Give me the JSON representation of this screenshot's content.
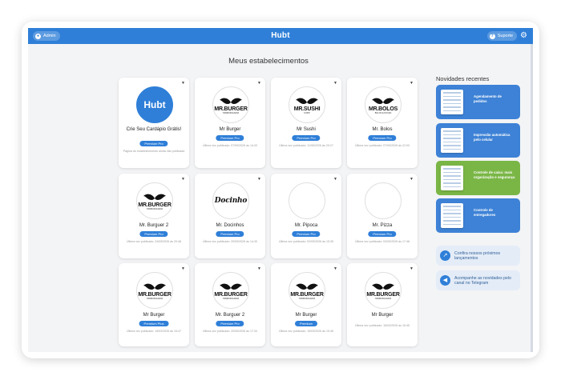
{
  "header": {
    "brand": "Hubt",
    "admin_label": "Admin",
    "support_label": "Suporte",
    "brand_color": "#2f7fd8"
  },
  "main": {
    "title": "Meus estabelecimentos",
    "cards": [
      {
        "logo_text": "Hubt",
        "logo_sub": "",
        "name": "Crie Seu Cardápio Grátis!",
        "plan": "Premium Pro",
        "meta": "Página do estabelecimento ainda não publicada"
      },
      {
        "logo_text": "MR.BURGER",
        "logo_sub": "HAMBURGUERIA",
        "name": "Mr Burger",
        "plan": "Premium Pro",
        "meta": "Última vez publicado: 07/09/2026 às 14:43"
      },
      {
        "logo_text": "MR.SUSHI",
        "logo_sub": "SUSHI",
        "name": "Mr Sushi",
        "plan": "Premium Pro",
        "meta": "Última vez publicado: 11/06/2026 às 20:27"
      },
      {
        "logo_text": "MR.BOLOS",
        "logo_sub": "BOLOS E DOCES",
        "name": "Mr. Bolos",
        "plan": "Premium Pro",
        "meta": "Última vez publicado: 07/09/2026 às 22:00"
      },
      {
        "logo_text": "MR.BURGER",
        "logo_sub": "HAMBURGUERIA",
        "name": "Mr. Burguer 2",
        "plan": "Premium Pro",
        "meta": "Última vez publicado: 24/09/2026 às 20:48"
      },
      {
        "logo_text": "Docinho",
        "logo_sub": "",
        "name": "Mr. Docinhos",
        "plan": "Premium Pro",
        "meta": "Última vez publicado: 20/09/2026 às 14:40"
      },
      {
        "logo_text": "",
        "logo_sub": "",
        "name": "Mr. Pipoca",
        "plan": "Premium Pro",
        "meta": "Última vez publicado: 02/09/2026 às 15:35"
      },
      {
        "logo_text": "",
        "logo_sub": "",
        "name": "Mr. Pizza",
        "plan": "Premium Pro",
        "meta": "Última vez publicado: 03/09/2026 às 17:48"
      },
      {
        "logo_text": "MR.BURGER",
        "logo_sub": "HAMBURGUERIA",
        "name": "Mr Burger",
        "plan": "Premium Plus",
        "meta": "Última vez publicado: 15/03/2026 às 15:47"
      },
      {
        "logo_text": "MR.BURGER",
        "logo_sub": "HAMBURGUERIA",
        "name": "Mr. Burguer 2",
        "plan": "Premium Pro",
        "meta": "Última vez publicado: 20/05/2026 às 17:34"
      },
      {
        "logo_text": "MR.BURGER",
        "logo_sub": "HAMBURGUERIA",
        "name": "Mr Burger",
        "plan": "Premium",
        "meta": "Última vez publicado: 15/03/2026 às 15:46"
      },
      {
        "logo_text": "MR.BURGER",
        "logo_sub": "HAMBURGUERIA",
        "name": "Mr Burger",
        "plan": "",
        "meta": "Última vez publicado: 15/03/2026 às 15:45"
      }
    ]
  },
  "news": {
    "title": "Novidades recentes",
    "cards": [
      {
        "text": "Agendamento de pedidos",
        "color": "#3d82d6"
      },
      {
        "text": "Impressão automática pelo celular",
        "color": "#3d82d6"
      },
      {
        "text": "Controle de caixa: mais organização e segurança",
        "color": "#7ab646"
      },
      {
        "text": "Controle de entregadores",
        "color": "#3d82d6"
      }
    ],
    "links": [
      {
        "text": "Confira nossos próximos lançamentos",
        "icon": "rocket-icon"
      },
      {
        "text": "Acompanhe as novidades pelo canal no Telegram",
        "icon": "megaphone-icon"
      }
    ]
  }
}
